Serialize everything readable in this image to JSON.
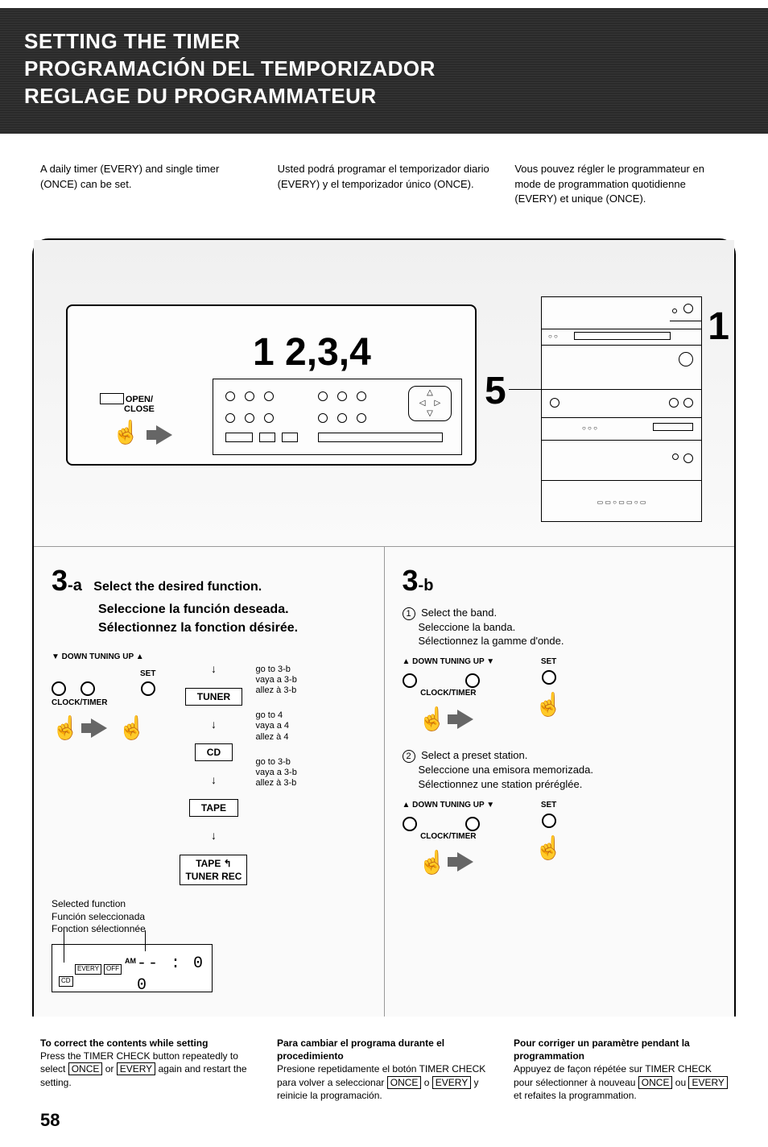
{
  "header": {
    "line1": "SETTING THE TIMER",
    "line2": "PROGRAMACIÓN DEL TEMPORIZADOR",
    "line3": "REGLAGE DU PROGRAMMATEUR"
  },
  "intro": {
    "en": "A daily timer (EVERY) and single timer (ONCE) can be set.",
    "es": "Usted podrá programar el temporizador diario (EVERY) y el temporizador único (ONCE).",
    "fr": "Vous pouvez régler le programmateur en mode de programmation quotidienne (EVERY) et unique (ONCE)."
  },
  "diagram": {
    "steps_label": "1 2,3,4",
    "callout_1": "1",
    "callout_5": "5",
    "open_close": "OPEN/\nCLOSE"
  },
  "step3a": {
    "num": "3",
    "sub": "-a",
    "h_en": "Select the desired function.",
    "h_es": "Seleccione la función deseada.",
    "h_fr": "Sélectionnez la fonction désirée.",
    "tuning_down": "▼ DOWN TUNING UP ▲",
    "set": "SET",
    "clock_timer": "CLOCK/TIMER",
    "funcs": {
      "tuner": "TUNER",
      "cd": "CD",
      "tape": "TAPE",
      "tape_rec": "TAPE ↰\nTUNER REC"
    },
    "goto": {
      "tuner": "go to 3-b\nvaya a 3-b\nallez à 3-b",
      "cd": "go to 4\nvaya a 4\nallez à 4",
      "tape": "go to 3-b\nvaya a 3-b\nallez à 3-b"
    },
    "selected": {
      "en": "Selected function",
      "es": "Función seleccionada",
      "fr": "Fonction sélectionnée"
    },
    "off": "OFF",
    "display": {
      "am": "AM",
      "every": "EVERY",
      "off_box": "OFF",
      "cd": "CD",
      "time": "-- : 0 0"
    }
  },
  "step3b": {
    "num": "3",
    "sub": "-b",
    "item1": {
      "en": "Select the band.",
      "es": "Seleccione la banda.",
      "fr": "Sélectionnez la gamme d'onde."
    },
    "item2": {
      "en": "Select a preset station.",
      "es": "Seleccione una emisora memorizada.",
      "fr": "Sélectionnez une station préréglée."
    },
    "tuning": "▲ DOWN    TUNING    UP ▼",
    "set": "SET",
    "clock_timer": "CLOCK/TIMER"
  },
  "footer": {
    "en": {
      "title": "To correct the contents while setting",
      "body1": "Press the TIMER CHECK button repeatedly to select ",
      "once": "ONCE",
      "or": " or ",
      "every": "EVERY",
      "body2": " again and restart the setting."
    },
    "es": {
      "title": "Para cambiar el programa durante el procedimiento",
      "body1": "Presione repetidamente el botón TIMER CHECK para volver a seleccionar ",
      "once": "ONCE",
      "o": " o ",
      "every": "EVERY",
      "body2": " y reinicie la programación."
    },
    "fr": {
      "title": "Pour corriger un paramètre pendant la programmation",
      "body1": "Appuyez de façon répétée sur TIMER CHECK pour sélectionner à nouveau ",
      "once": "ONCE",
      "ou": " ou ",
      "every": "EVERY",
      "body2": " et refaites la programmation."
    }
  },
  "page_number": "58"
}
